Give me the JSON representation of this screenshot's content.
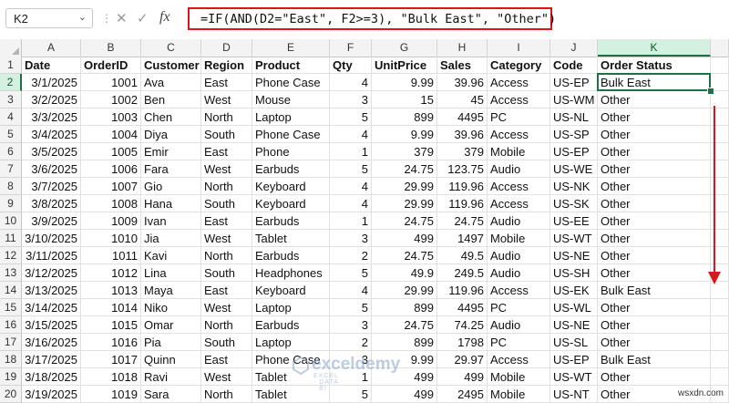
{
  "formula_bar": {
    "name_box": "K2",
    "fx_label": "fx",
    "formula": "=IF(AND(D2=\"East\", F2>=3), \"Bulk East\", \"Other\")"
  },
  "sheet": {
    "columns": [
      "A",
      "B",
      "C",
      "D",
      "E",
      "F",
      "G",
      "H",
      "I",
      "J",
      "K"
    ],
    "selected_cell": "K2",
    "header_row": [
      "Date",
      "OrderID",
      "Customer",
      "Region",
      "Product",
      "Qty",
      "UnitPrice",
      "Sales",
      "Category",
      "Code",
      "Order Status"
    ],
    "rows": [
      [
        "3/1/2025",
        "1001",
        "Ava",
        "East",
        "Phone Case",
        "4",
        "9.99",
        "39.96",
        "Access",
        "US-EP",
        "Bulk East"
      ],
      [
        "3/2/2025",
        "1002",
        "Ben",
        "West",
        "Mouse",
        "3",
        "15",
        "45",
        "Access",
        "US-WM",
        "Other"
      ],
      [
        "3/3/2025",
        "1003",
        "Chen",
        "North",
        "Laptop",
        "5",
        "899",
        "4495",
        "PC",
        "US-NL",
        "Other"
      ],
      [
        "3/4/2025",
        "1004",
        "Diya",
        "South",
        "Phone Case",
        "4",
        "9.99",
        "39.96",
        "Access",
        "US-SP",
        "Other"
      ],
      [
        "3/5/2025",
        "1005",
        "Emir",
        "East",
        "Phone",
        "1",
        "379",
        "379",
        "Mobile",
        "US-EP",
        "Other"
      ],
      [
        "3/6/2025",
        "1006",
        "Fara",
        "West",
        "Earbuds",
        "5",
        "24.75",
        "123.75",
        "Audio",
        "US-WE",
        "Other"
      ],
      [
        "3/7/2025",
        "1007",
        "Gio",
        "North",
        "Keyboard",
        "4",
        "29.99",
        "119.96",
        "Access",
        "US-NK",
        "Other"
      ],
      [
        "3/8/2025",
        "1008",
        "Hana",
        "South",
        "Keyboard",
        "4",
        "29.99",
        "119.96",
        "Access",
        "US-SK",
        "Other"
      ],
      [
        "3/9/2025",
        "1009",
        "Ivan",
        "East",
        "Earbuds",
        "1",
        "24.75",
        "24.75",
        "Audio",
        "US-EE",
        "Other"
      ],
      [
        "3/10/2025",
        "1010",
        "Jia",
        "West",
        "Tablet",
        "3",
        "499",
        "1497",
        "Mobile",
        "US-WT",
        "Other"
      ],
      [
        "3/11/2025",
        "1011",
        "Kavi",
        "North",
        "Earbuds",
        "2",
        "24.75",
        "49.5",
        "Audio",
        "US-NE",
        "Other"
      ],
      [
        "3/12/2025",
        "1012",
        "Lina",
        "South",
        "Headphones",
        "5",
        "49.9",
        "249.5",
        "Audio",
        "US-SH",
        "Other"
      ],
      [
        "3/13/2025",
        "1013",
        "Maya",
        "East",
        "Keyboard",
        "4",
        "29.99",
        "119.96",
        "Access",
        "US-EK",
        "Bulk East"
      ],
      [
        "3/14/2025",
        "1014",
        "Niko",
        "West",
        "Laptop",
        "5",
        "899",
        "4495",
        "PC",
        "US-WL",
        "Other"
      ],
      [
        "3/15/2025",
        "1015",
        "Omar",
        "North",
        "Earbuds",
        "3",
        "24.75",
        "74.25",
        "Audio",
        "US-NE",
        "Other"
      ],
      [
        "3/16/2025",
        "1016",
        "Pia",
        "South",
        "Laptop",
        "2",
        "899",
        "1798",
        "PC",
        "US-SL",
        "Other"
      ],
      [
        "3/17/2025",
        "1017",
        "Quinn",
        "East",
        "Phone Case",
        "3",
        "9.99",
        "29.97",
        "Access",
        "US-EP",
        "Bulk East"
      ],
      [
        "3/18/2025",
        "1018",
        "Ravi",
        "West",
        "Tablet",
        "1",
        "499",
        "499",
        "Mobile",
        "US-WT",
        "Other"
      ],
      [
        "3/19/2025",
        "1019",
        "Sara",
        "North",
        "Tablet",
        "5",
        "499",
        "2495",
        "Mobile",
        "US-NT",
        "Other"
      ]
    ]
  },
  "watermark": {
    "name": "exceldemy",
    "tagline": "EXCEL · DATA · BI"
  },
  "site_label": "wsxdn.com",
  "colors": {
    "selection": "#1e7145",
    "annotation": "#e0121c"
  }
}
